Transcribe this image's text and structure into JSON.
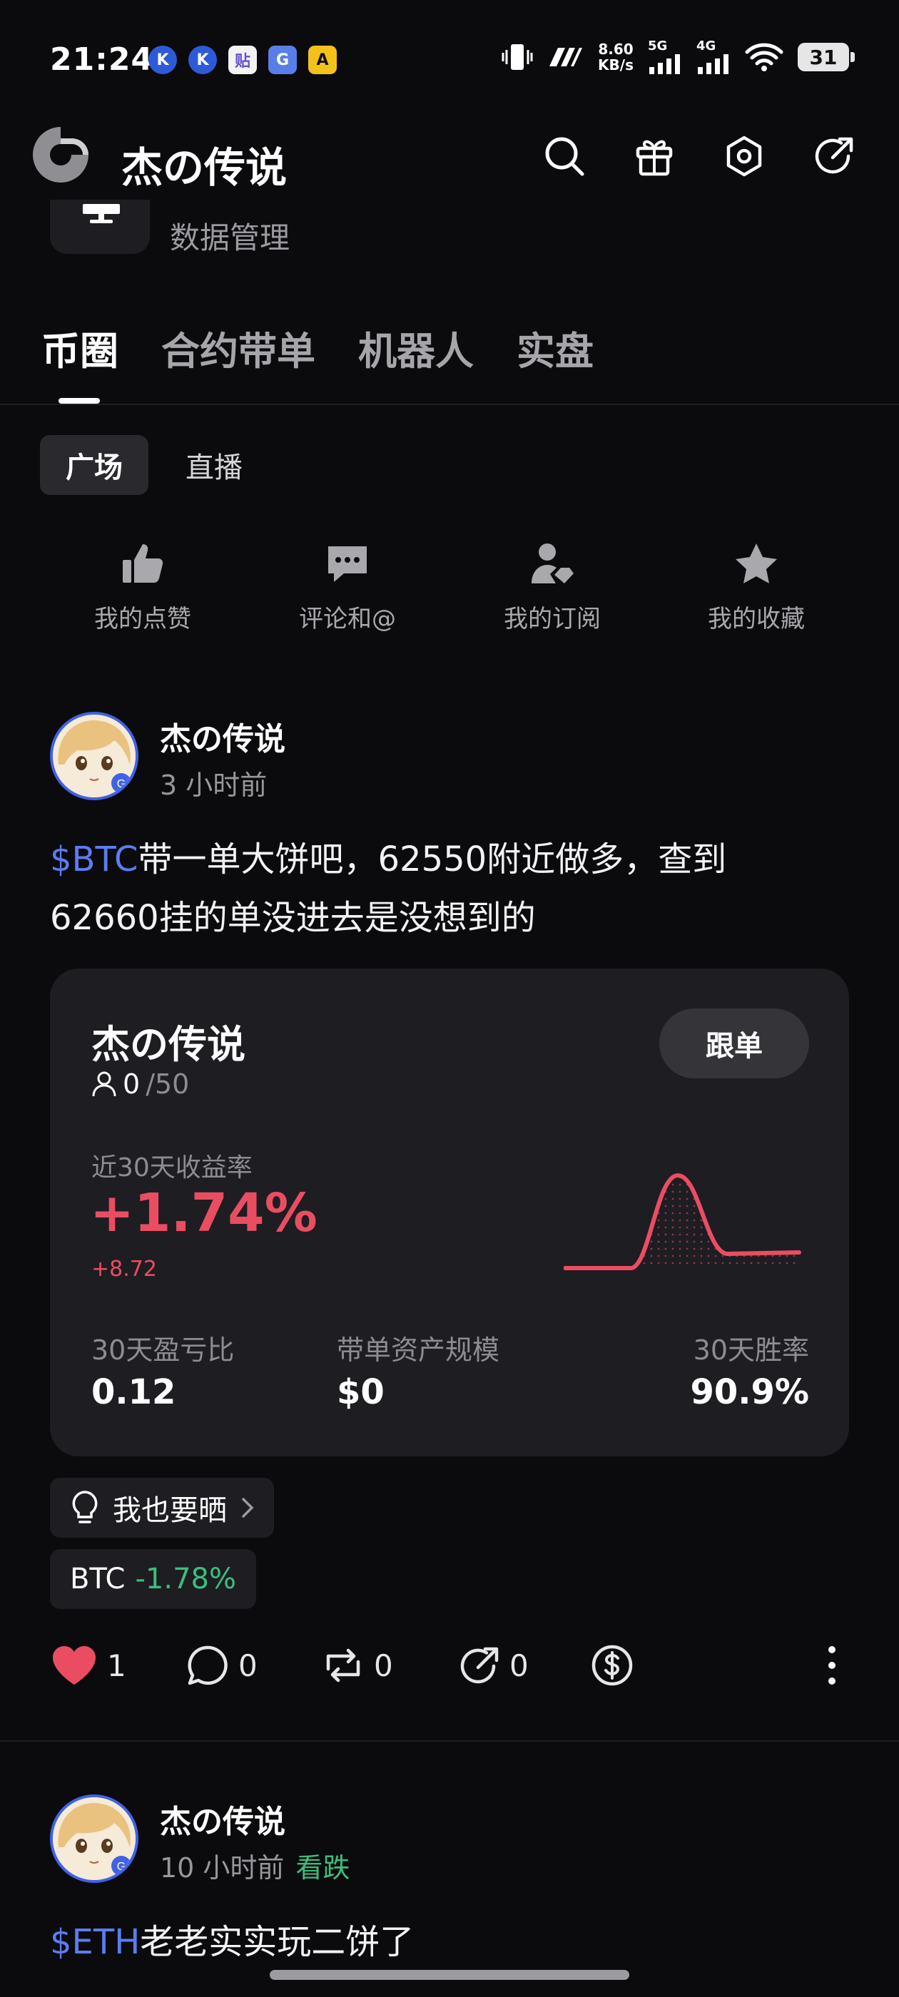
{
  "status_bar": {
    "time": "21:24",
    "notification_icons": [
      "K",
      "K",
      "贴",
      "G",
      "A"
    ],
    "net_speed_value": "8.60",
    "net_speed_unit": "KB/s",
    "signal_1": "5G",
    "signal_2": "4G",
    "battery": "31"
  },
  "header": {
    "title": "杰の传说",
    "icons": [
      "search-icon",
      "gift-icon",
      "settings-icon",
      "share-icon"
    ]
  },
  "peek_item": {
    "label": "数据管理"
  },
  "main_tabs": [
    "币圈",
    "合约带单",
    "机器人",
    "实盘"
  ],
  "sub_tabs": [
    "广场",
    "直播"
  ],
  "quick_actions": [
    {
      "label": "我的点赞",
      "icon": "thumbs-up-icon"
    },
    {
      "label": "评论和@",
      "icon": "comment-icon"
    },
    {
      "label": "我的订阅",
      "icon": "subscription-icon"
    },
    {
      "label": "我的收藏",
      "icon": "star-icon"
    }
  ],
  "posts": [
    {
      "author": "杰の传说",
      "time": "3 小时前",
      "ticker": "$BTC",
      "text_line1": "带一单大饼吧，62550附近做多，查到",
      "text_line2": "62660挂的单没进去是没想到的",
      "card": {
        "name": "杰の传说",
        "followers": "0",
        "followers_max": "/50",
        "follow_label": "跟单",
        "roi_label": "近30天收益率",
        "roi_value": "+1.74%",
        "roi_abs": "+8.72",
        "stats": [
          {
            "label": "30天盈亏比",
            "value": "0.12"
          },
          {
            "label": "带单资产规模",
            "value": "$0"
          },
          {
            "label": "30天胜率",
            "value": "90.9%"
          }
        ],
        "color_positive": "#ea4d62"
      },
      "share_chip": "我也要晒",
      "coin_chip": {
        "symbol": "BTC",
        "change": "-1.78%"
      },
      "actions": {
        "likes": "1",
        "comments": "0",
        "reposts": "0",
        "shares": "0"
      }
    },
    {
      "author": "杰の传说",
      "time": "10 小时前",
      "sentiment": "看跌",
      "ticker": "$ETH",
      "text_line1": "老老实实玩二饼了"
    }
  ],
  "colors": {
    "accent_blue": "#5b7cf2",
    "up_red": "#ea4d62",
    "down_green": "#3dbd7d",
    "background": "#0b0b0d"
  }
}
